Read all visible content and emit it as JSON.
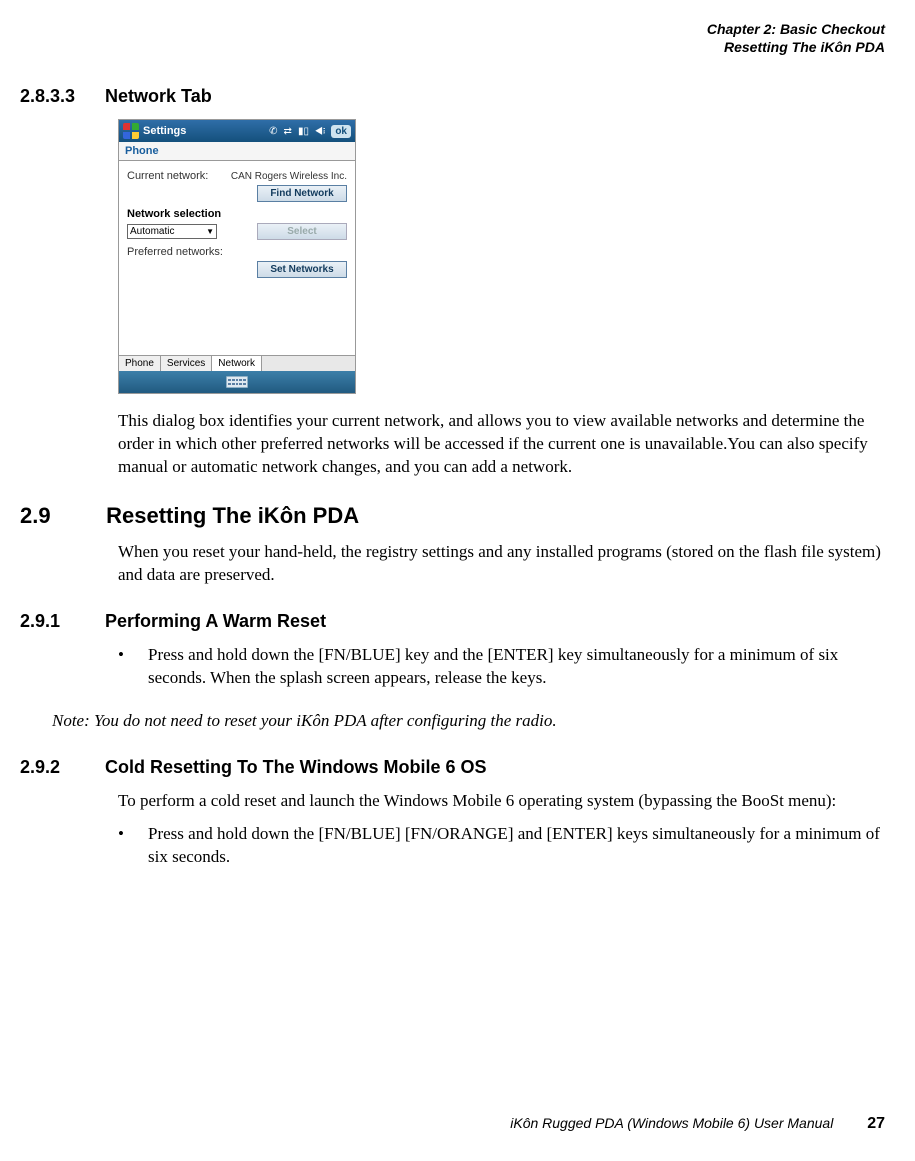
{
  "header": {
    "chapter": "Chapter 2: Basic Checkout",
    "section": "Resetting The iKôn PDA"
  },
  "sections": {
    "s1": {
      "num": "2.8.3.3",
      "title": "Network Tab"
    },
    "s2": {
      "num": "2.9",
      "title": "Resetting The iKôn PDA"
    },
    "s3": {
      "num": "2.9.1",
      "title": "Performing A Warm Reset"
    },
    "s4": {
      "num": "2.9.2",
      "title": "Cold Resetting To The Windows Mobile 6 OS"
    }
  },
  "pda": {
    "title": "Settings",
    "ok": "ok",
    "header2": "Phone",
    "current_network_label": "Current network:",
    "current_network_value": "CAN Rogers Wireless Inc.",
    "find_network_btn": "Find Network",
    "network_selection_label": "Network selection",
    "mode": "Automatic",
    "select_btn": "Select",
    "preferred_label": "Preferred networks:",
    "set_networks_btn": "Set Networks",
    "tabs": [
      "Phone",
      "Services",
      "Network"
    ]
  },
  "paragraphs": {
    "p1": "This dialog box identifies your current network, and allows you to view available networks and determine the order in which other preferred networks will be accessed if the current one is unavailable.You can also specify manual or automatic network changes, and you can add a network.",
    "p2": "When you reset your hand-held, the registry settings and any installed programs (stored on the flash file system) and data are preserved.",
    "bullet1": "Press and hold down the [FN/BLUE] key and the [ENTER] key simultaneously for a minimum of six seconds. When the splash screen appears, release the keys.",
    "note": "Note: You do not need to reset your iKôn PDA after configuring the radio.",
    "p3": "To perform a cold reset and launch the Windows Mobile 6 operating system (bypassing the BooSt menu):",
    "bullet2": "Press and hold down the [FN/BLUE] [FN/ORANGE] and [ENTER] keys simultaneously for a minimum of six seconds."
  },
  "footer": {
    "title": "iKôn Rugged PDA (Windows Mobile 6) User Manual",
    "page": "27"
  }
}
